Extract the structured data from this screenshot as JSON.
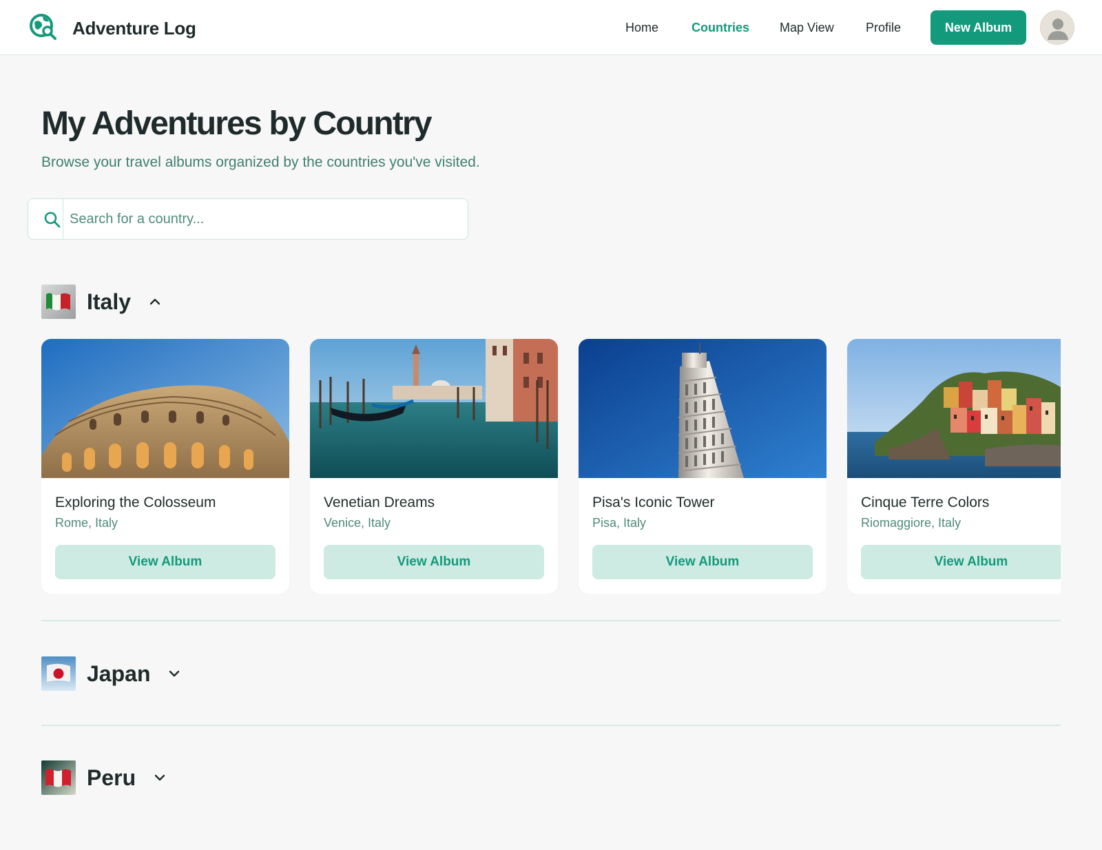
{
  "app": {
    "brand": "Adventure Log",
    "logo_icon": "globe-search-icon",
    "accent_color": "#139a7c"
  },
  "nav": {
    "links": [
      {
        "label": "Home",
        "active": false
      },
      {
        "label": "Countries",
        "active": true
      },
      {
        "label": "Map View",
        "active": false
      },
      {
        "label": "Profile",
        "active": false
      }
    ],
    "new_album_label": "New Album",
    "avatar_icon": "user-avatar-icon"
  },
  "header": {
    "title": "My Adventures by Country",
    "subtitle": "Browse your travel albums organized by the countries you've visited."
  },
  "search": {
    "placeholder": "Search for a country...",
    "value": "",
    "icon": "search-icon"
  },
  "countries": [
    {
      "name": "Italy",
      "expanded": true,
      "flag_icon": "italy-flag-icon",
      "albums": [
        {
          "title": "Exploring the Colosseum",
          "location": "Rome, Italy",
          "button": "View Album"
        },
        {
          "title": "Venetian Dreams",
          "location": "Venice, Italy",
          "button": "View Album"
        },
        {
          "title": "Pisa's Iconic Tower",
          "location": "Pisa, Italy",
          "button": "View Album"
        },
        {
          "title": "Cinque Terre Colors",
          "location": "Riomaggiore, Italy",
          "button": "View Album"
        }
      ]
    },
    {
      "name": "Japan",
      "expanded": false,
      "flag_icon": "japan-flag-icon",
      "albums": []
    },
    {
      "name": "Peru",
      "expanded": false,
      "flag_icon": "peru-flag-icon",
      "albums": []
    }
  ]
}
